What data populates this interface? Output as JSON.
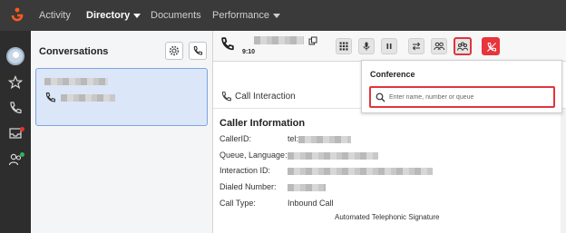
{
  "nav": {
    "items": [
      {
        "label": "Activity"
      },
      {
        "label": "Directory"
      },
      {
        "label": "Documents"
      },
      {
        "label": "Performance"
      }
    ]
  },
  "conversations": {
    "title": "Conversations"
  },
  "call": {
    "timer": "9:10"
  },
  "interaction": {
    "tab_label": "Call Interaction",
    "section_title": "Caller Information",
    "fields": [
      {
        "label": "CallerID:",
        "value_prefix": "tel:"
      },
      {
        "label": "Queue, Language:"
      },
      {
        "label": "Interaction ID:"
      },
      {
        "label": "Dialed Number:"
      },
      {
        "label": "Call Type:",
        "value": "Inbound Call"
      }
    ],
    "signature": "Automated Telephonic Signature"
  },
  "conference": {
    "title": "Conference",
    "placeholder": "Enter name, number or queue"
  },
  "colors": {
    "accent_red": "#e0363b",
    "nav_bg": "#3a3a3a",
    "card_selected": "#dbe6f8"
  }
}
